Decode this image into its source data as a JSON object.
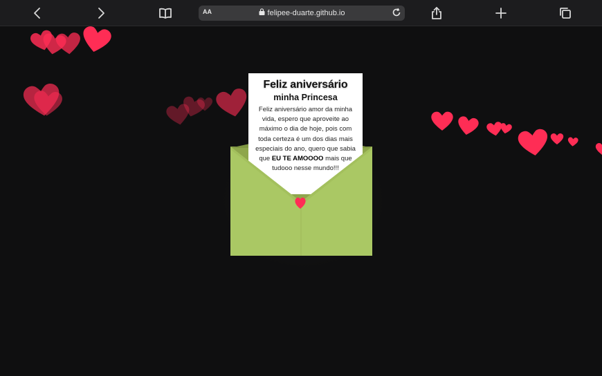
{
  "browser": {
    "back_icon": "chevron-left-icon",
    "forward_icon": "chevron-right-icon",
    "bookmarks_icon": "book-icon",
    "text_size_label": "AA",
    "url": "felipee-duarte.github.io",
    "share_icon": "share-icon",
    "new_tab_icon": "plus-icon",
    "tabs_icon": "tabs-icon"
  },
  "letter": {
    "title": "Feliz aniversário",
    "subtitle": "minha Princesa",
    "body_before": "Feliz aniversário amor da minha vida, espero que aproveite ao máximo o dia de hoje, pois com toda certeza é um dos dias mais especiais do ano, quero que sabia que ",
    "body_bold": "EU TE AMOOOO",
    "body_after": " mais que tudooo nesse mundo!!!"
  },
  "colors": {
    "background": "#0f0f10",
    "heart": "#ff2d55",
    "envelope": "#a9c763",
    "envelope_dark": "#8ea64c",
    "seal": "#ff2d55"
  }
}
